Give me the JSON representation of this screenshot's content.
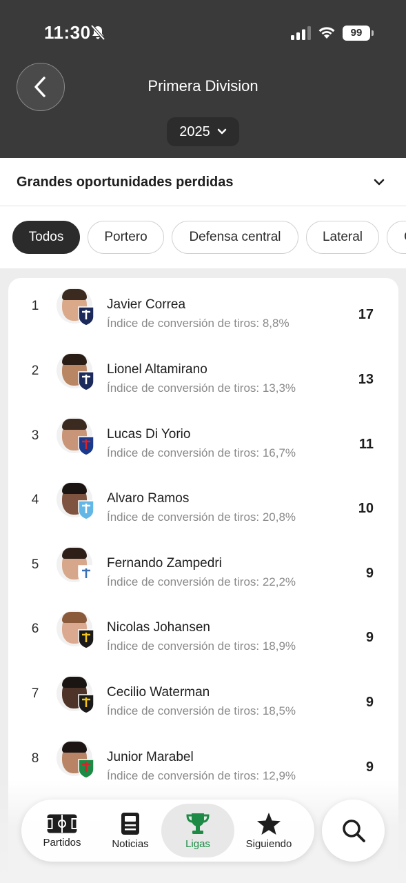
{
  "status_bar": {
    "time": "11:30",
    "battery": "99"
  },
  "header": {
    "title": "Primera Division",
    "season": "2025"
  },
  "stat_selector": {
    "label": "Grandes oportunidades perdidas"
  },
  "filters": [
    {
      "label": "Todos",
      "active": true
    },
    {
      "label": "Portero",
      "active": false
    },
    {
      "label": "Defensa central",
      "active": false
    },
    {
      "label": "Lateral",
      "active": false
    },
    {
      "label": "C",
      "active": false
    }
  ],
  "players": [
    {
      "rank": "1",
      "name": "Javier Correa",
      "sub": "Índice de conversión de tiros: 8,8%",
      "value": "17",
      "skin": "#d9a98a",
      "hair": "#3a2a20",
      "club_color": "#1b2a5a",
      "club_accent": "#ffffff"
    },
    {
      "rank": "2",
      "name": "Lionel Altamirano",
      "sub": "Índice de conversión de tiros: 13,3%",
      "value": "13",
      "skin": "#b98664",
      "hair": "#2a1d16",
      "club_color": "#1b2a5a",
      "club_accent": "#ffffff"
    },
    {
      "rank": "3",
      "name": "Lucas Di Yorio",
      "sub": "Índice de conversión de tiros: 16,7%",
      "value": "11",
      "skin": "#c99578",
      "hair": "#3a2a1f",
      "club_color": "#1c3a8c",
      "club_accent": "#d6232a"
    },
    {
      "rank": "4",
      "name": "Alvaro Ramos",
      "sub": "Índice de conversión de tiros: 20,8%",
      "value": "10",
      "skin": "#7e5440",
      "hair": "#1a1412",
      "club_color": "#63b7e6",
      "club_accent": "#ffffff"
    },
    {
      "rank": "5",
      "name": "Fernando Zampedri",
      "sub": "Índice de conversión de tiros: 22,2%",
      "value": "9",
      "skin": "#d6a78a",
      "hair": "#2d1e17",
      "club_color": "#ffffff",
      "club_accent": "#3b6fb6"
    },
    {
      "rank": "6",
      "name": "Nicolas Johansen",
      "sub": "Índice de conversión de tiros: 18,9%",
      "value": "9",
      "skin": "#dba98f",
      "hair": "#8a5a3a",
      "club_color": "#1a1a1a",
      "club_accent": "#f3c317"
    },
    {
      "rank": "7",
      "name": "Cecilio Waterman",
      "sub": "Índice de conversión de tiros: 18,5%",
      "value": "9",
      "skin": "#4e3328",
      "hair": "#1a1412",
      "club_color": "#1a1a1a",
      "club_accent": "#f3c317"
    },
    {
      "rank": "8",
      "name": "Junior Marabel",
      "sub": "Índice de conversión de tiros: 12,9%",
      "value": "9",
      "skin": "#b88465",
      "hair": "#1d1513",
      "club_color": "#1d8a45",
      "club_accent": "#d6232a"
    }
  ],
  "nav": {
    "items": [
      {
        "label": "Partidos",
        "icon": "pitch-icon"
      },
      {
        "label": "Noticias",
        "icon": "news-icon"
      },
      {
        "label": "Ligas",
        "icon": "trophy-icon"
      },
      {
        "label": "Siguiendo",
        "icon": "star-icon"
      }
    ],
    "active_color": "#1d8a45"
  }
}
